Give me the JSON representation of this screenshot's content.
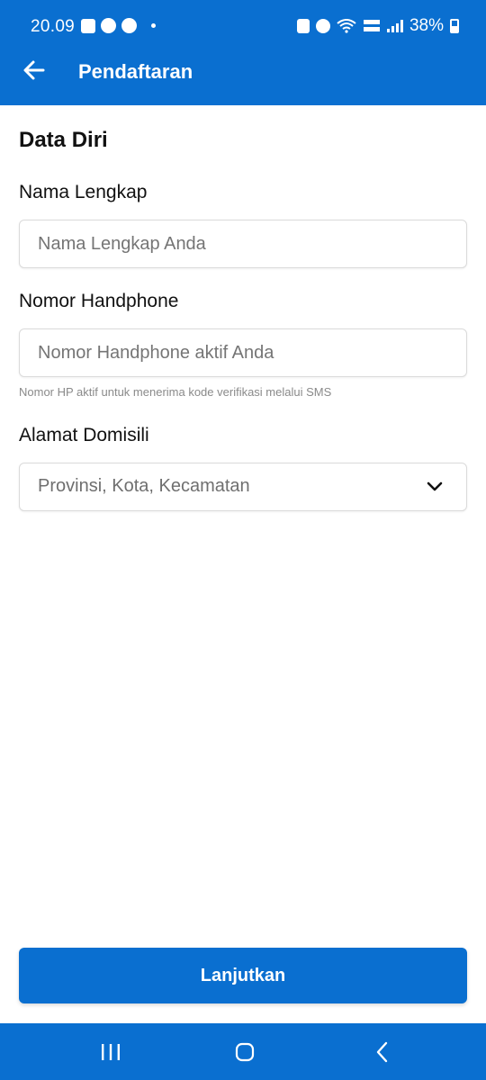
{
  "status_bar": {
    "time": "20.09",
    "battery": "38%",
    "icons": [
      "gallery-icon",
      "app-icon",
      "app-icon",
      "dot-icon",
      "lock-icon",
      "alarm-icon",
      "wifi-icon",
      "volte-icon",
      "signal-icon",
      "battery-icon"
    ]
  },
  "appbar": {
    "title": "Pendaftaran",
    "back_icon": "arrow-left-icon"
  },
  "form": {
    "section_title": "Data Diri",
    "name": {
      "label": "Nama Lengkap",
      "placeholder": "Nama Lengkap Anda",
      "value": ""
    },
    "phone": {
      "label": "Nomor Handphone",
      "placeholder": "Nomor Handphone aktif Anda",
      "value": "",
      "helper": "Nomor HP aktif untuk menerima kode verifikasi melalui SMS"
    },
    "address": {
      "label": "Alamat Domisili",
      "placeholder": "Provinsi, Kota, Kecamatan",
      "dropdown_icon": "chevron-down-icon"
    }
  },
  "cta": {
    "label": "Lanjutkan"
  },
  "nav": {
    "recent_icon": "recents-icon",
    "home_icon": "home-icon",
    "back_icon": "back-icon"
  },
  "colors": {
    "primary": "#0a6fd0",
    "background": "#ffffff",
    "text": "#111111",
    "placeholder": "#757575"
  }
}
